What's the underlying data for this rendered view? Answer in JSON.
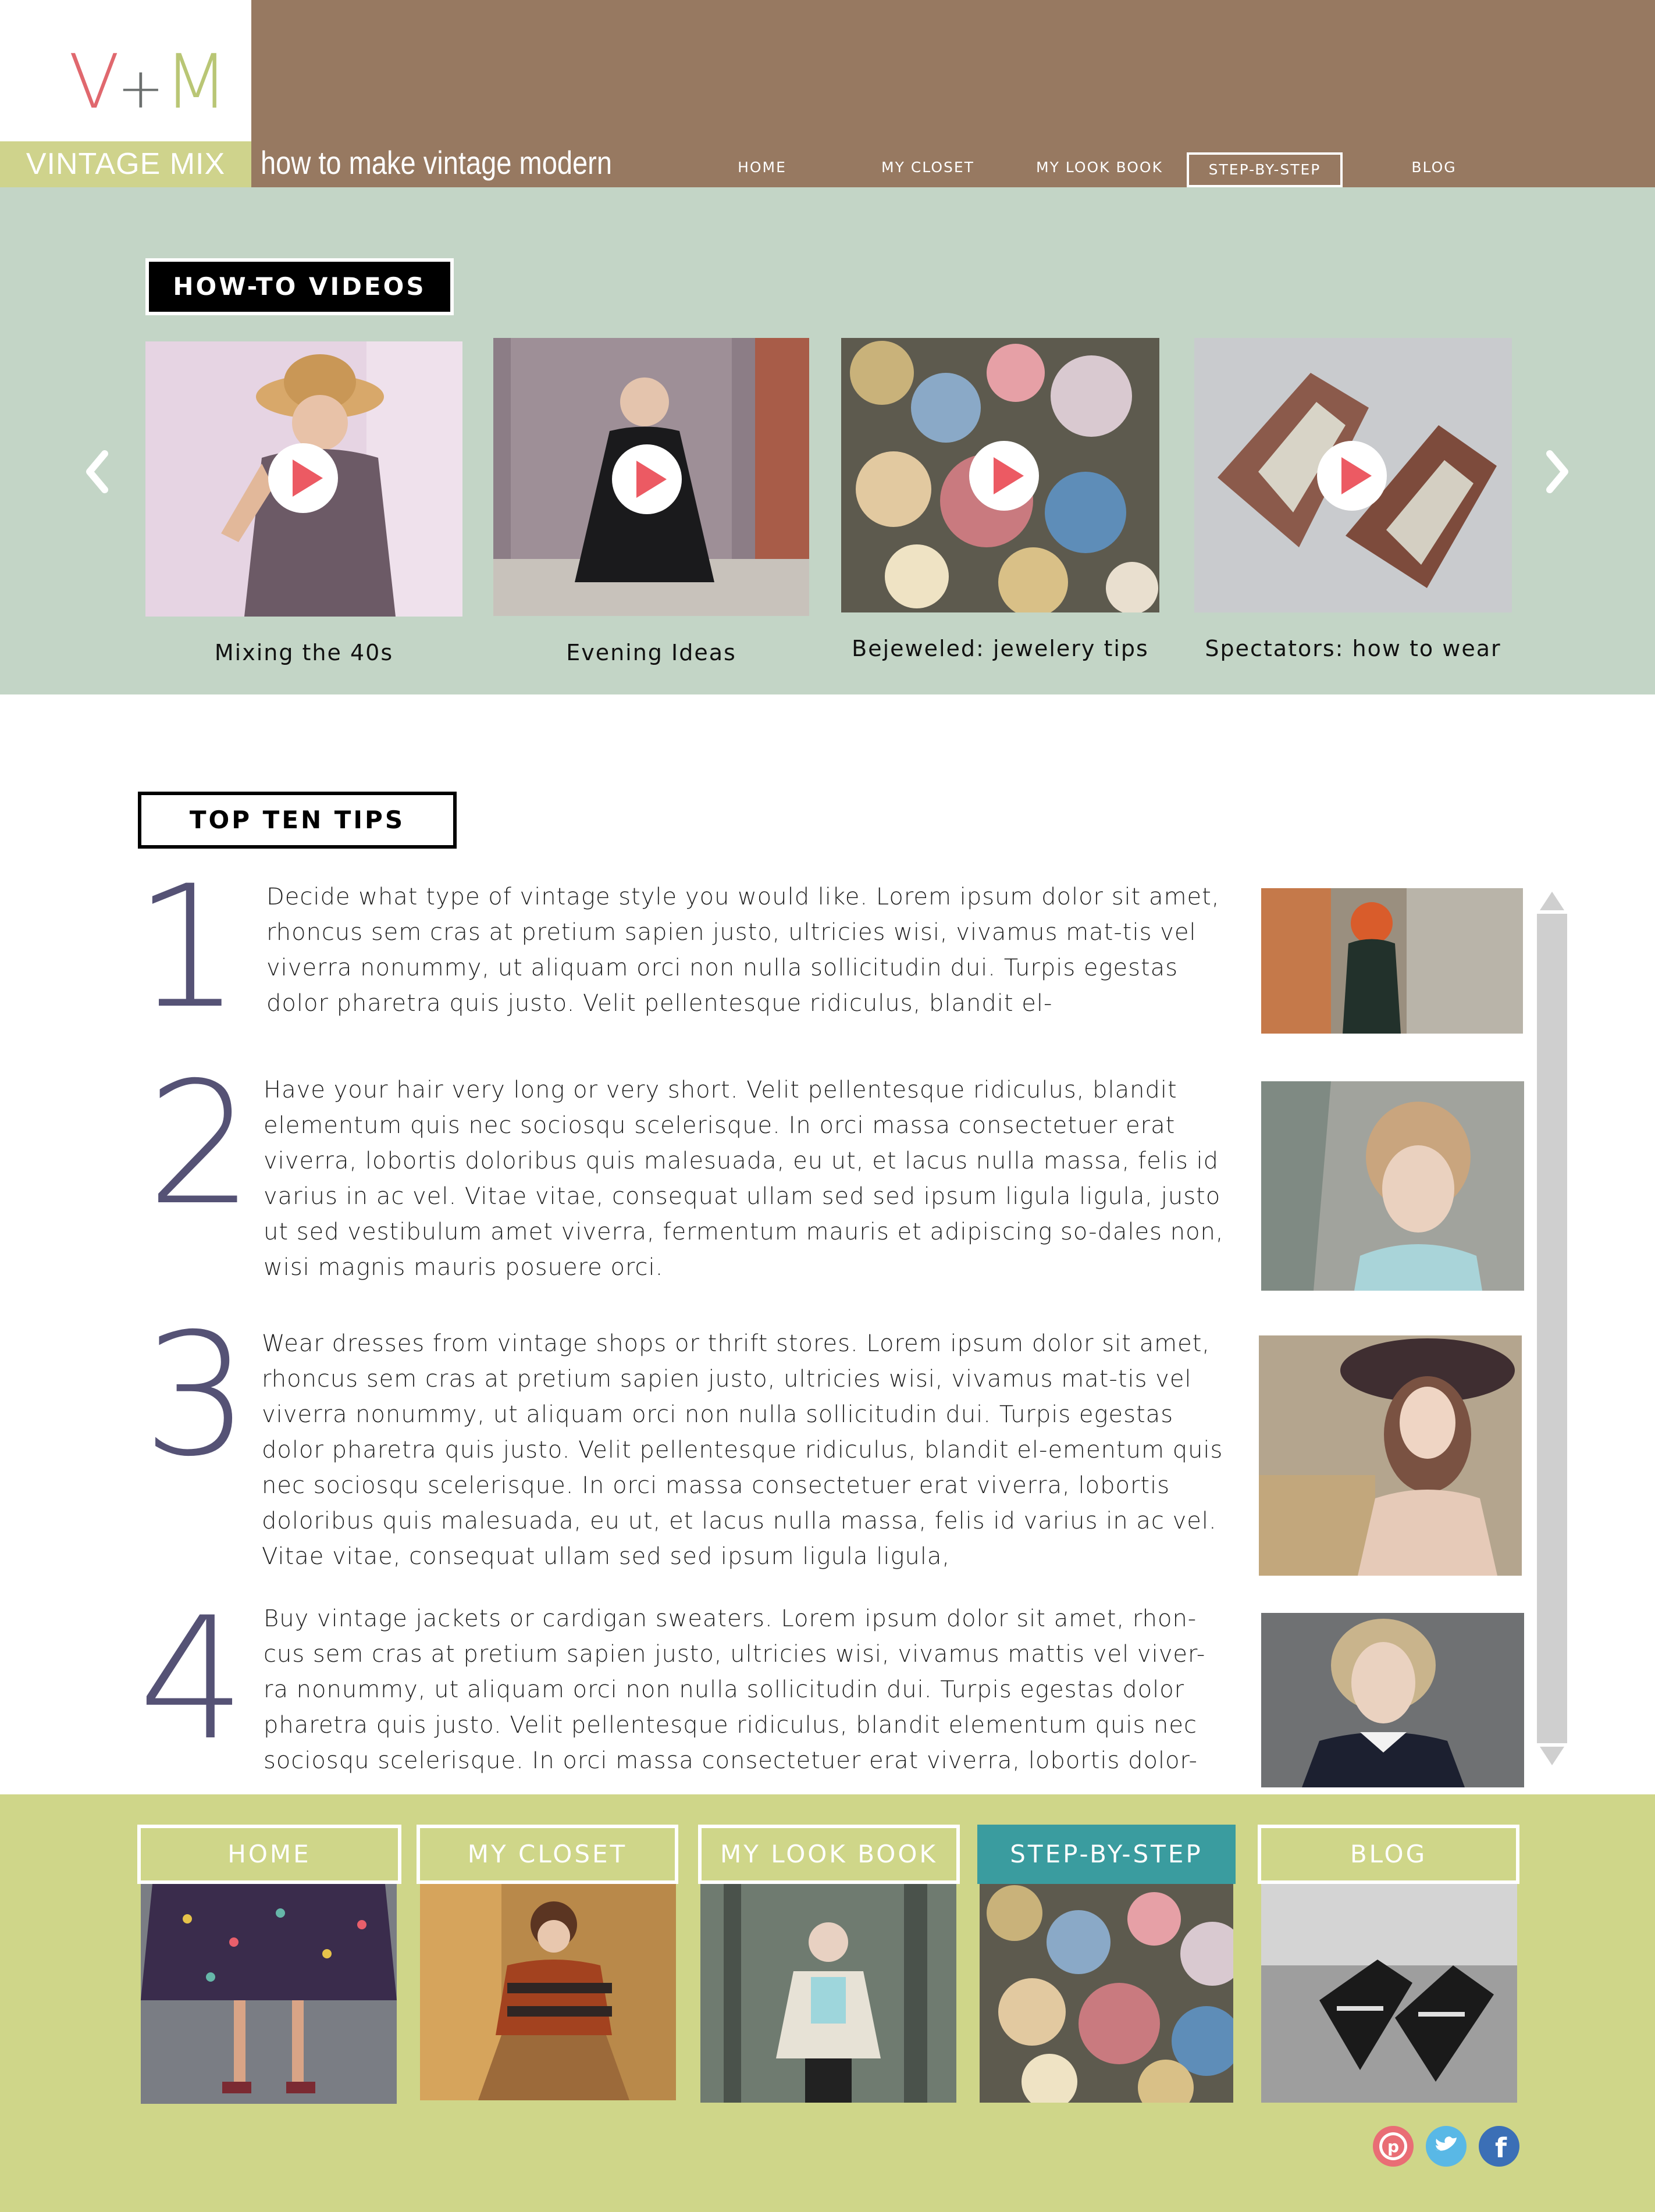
{
  "header": {
    "logo": {
      "v": "V",
      "plus": "+",
      "m": "M"
    },
    "brand": "VINTAGE MIX",
    "tagline": "how to make vintage modern",
    "nav": [
      {
        "label": "HOME"
      },
      {
        "label": "MY CLOSET"
      },
      {
        "label": "MY LOOK BOOK"
      },
      {
        "label": "STEP-BY-STEP",
        "active": true
      },
      {
        "label": "BLOG"
      }
    ]
  },
  "videos": {
    "title": "HOW-TO VIDEOS",
    "items": [
      {
        "caption": "Mixing the 40s"
      },
      {
        "caption": "Evening Ideas"
      },
      {
        "caption": "Bejeweled: jewelery tips"
      },
      {
        "caption": "Spectators: how to wear"
      }
    ]
  },
  "tips": {
    "title": "TOP TEN TIPS",
    "items": [
      {
        "number": "1",
        "text": "Decide what type of vintage style you would like. Lorem ipsum dolor sit amet, rhoncus sem cras at pretium sapien justo, ultricies wisi, vivamus mat-tis vel viverra nonummy, ut aliquam orci non nulla sollicitudin dui. Turpis egestas dolor pharetra quis justo. Velit pellentesque ridiculus, blandit el-"
      },
      {
        "number": "2",
        "text": "Have your hair very long or very short. Velit pellentesque ridiculus, blandit elementum quis nec sociosqu scelerisque. In orci massa consectetuer erat viverra, lobortis doloribus quis malesuada, eu ut, et lacus nulla massa, felis id varius in ac vel. Vitae vitae, consequat ullam sed sed ipsum ligula ligula, justo ut sed vestibulum amet viverra, fermentum mauris et adipiscing so-dales non, wisi magnis mauris posuere orci."
      },
      {
        "number": "3",
        "text": "Wear dresses from vintage shops or thrift stores. Lorem ipsum dolor sit amet, rhoncus sem cras at pretium sapien justo, ultricies wisi, vivamus mat-tis vel viverra nonummy, ut aliquam orci non nulla sollicitudin dui. Turpis egestas dolor pharetra quis justo. Velit pellentesque ridiculus, blandit el-ementum quis nec sociosqu scelerisque. In orci massa consectetuer erat viverra, lobortis doloribus quis malesuada, eu ut, et lacus nulla massa, felis id varius in ac vel. Vitae vitae, consequat ullam sed sed ipsum ligula ligula,"
      },
      {
        "number": "4",
        "text": "Buy vintage jackets or cardigan sweaters. Lorem ipsum dolor sit amet, rhon-cus sem cras at pretium sapien justo, ultricies wisi, vivamus mattis vel viver-ra nonummy, ut aliquam orci non nulla sollicitudin dui. Turpis egestas dolor pharetra quis justo. Velit pellentesque ridiculus, blandit elementum quis nec sociosqu scelerisque. In orci massa consectetuer erat viverra, lobortis dolor-"
      }
    ]
  },
  "footer": {
    "tabs": [
      {
        "label": "HOME"
      },
      {
        "label": "MY CLOSET"
      },
      {
        "label": "MY LOOK BOOK"
      },
      {
        "label": "STEP-BY-STEP",
        "active": true
      },
      {
        "label": "BLOG"
      }
    ],
    "social": [
      "pinterest-icon",
      "twitter-icon",
      "facebook-icon"
    ]
  },
  "colors": {
    "header_brown": "#977961",
    "logo_v": "#e0686e",
    "logo_m": "#b9c675",
    "brand_green": "#cfd38c",
    "video_bg": "#c3d5c6",
    "tip_number": "#555275",
    "footer_bg": "#cfd689",
    "active_tab": "#3a9c9f"
  }
}
